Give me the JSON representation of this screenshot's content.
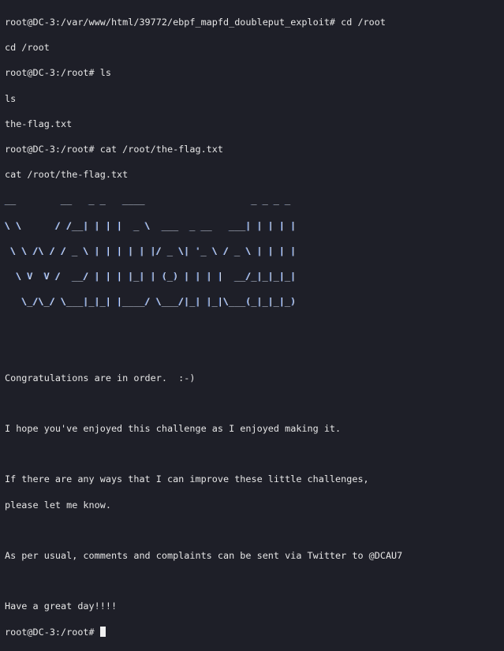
{
  "terminal": {
    "lines": [
      "root@DC-3:/var/www/html/39772/ebpf_mapfd_doubleput_exploit# cd /root",
      "cd /root",
      "root@DC-3:/root# ls",
      "ls",
      "the-flag.txt",
      "root@DC-3:/root# cat /root/the-flag.txt",
      "cat /root/the-flag.txt"
    ],
    "art": [
      "__        __   _ _   ____                   _ _ _ _ ",
      "\\ \\      / /__| | | |  _ \\  ___  _ __   ___| | | | |",
      " \\ \\ /\\ / / _ \\ | | | | | |/ _ \\| '_ \\ / _ \\ | | | |",
      "  \\ V  V /  __/ | | | |_| | (_) | | | |  __/_|_|_|_|",
      "   \\_/\\_/ \\___|_|_| |____/ \\___/|_| |_|\\___(_|_|_|_)",
      ""
    ],
    "messages": [
      "",
      "Congratulations are in order.  :-)",
      "",
      "I hope you've enjoyed this challenge as I enjoyed making it.",
      "",
      "If there are any ways that I can improve these little challenges,",
      "please let me know.",
      "",
      "As per usual, comments and complaints can be sent via Twitter to @DCAU7",
      "",
      "Have a great day!!!!"
    ],
    "prompt": "root@DC-3:/root# "
  }
}
